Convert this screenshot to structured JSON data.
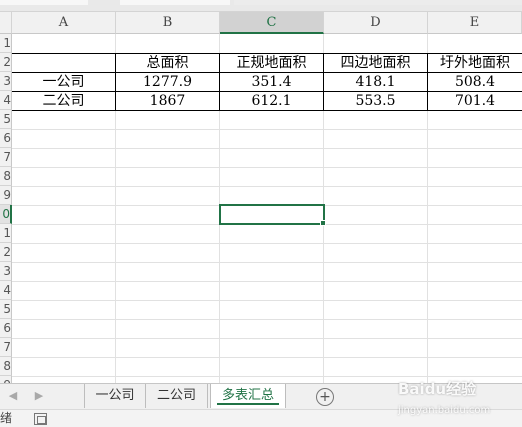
{
  "columns": [
    "A",
    "B",
    "C",
    "D",
    "E"
  ],
  "selected_column": "C",
  "row_numbers": [
    "1",
    "2",
    "3",
    "4",
    "5",
    "6",
    "7",
    "8",
    "9",
    "0",
    "1",
    "2",
    "3",
    "4",
    "5",
    "6",
    "7",
    "8",
    "9"
  ],
  "selected_row_label": "0",
  "table": {
    "headers": [
      "",
      "总面积",
      "正规地面积",
      "四边地面积",
      "圩外地面积"
    ],
    "rows": [
      [
        "一公司",
        "1277.9",
        "351.4",
        "418.1",
        "508.4"
      ],
      [
        "二公司",
        "1867",
        "612.1",
        "553.5",
        "701.4"
      ]
    ]
  },
  "sheet_tabs": [
    "一公司",
    "二公司",
    "多表汇总"
  ],
  "active_sheet": "多表汇总",
  "nav": {
    "prev": "◀",
    "next": "▶"
  },
  "add_sheet": "+",
  "status": {
    "text": "绪"
  },
  "watermark": {
    "text": "Baidu经验",
    "sub": "jingyan.baidu.com"
  },
  "colors": {
    "accent": "#217346",
    "grid": "#e1e1e1",
    "header_bg": "#f1f1f1"
  }
}
